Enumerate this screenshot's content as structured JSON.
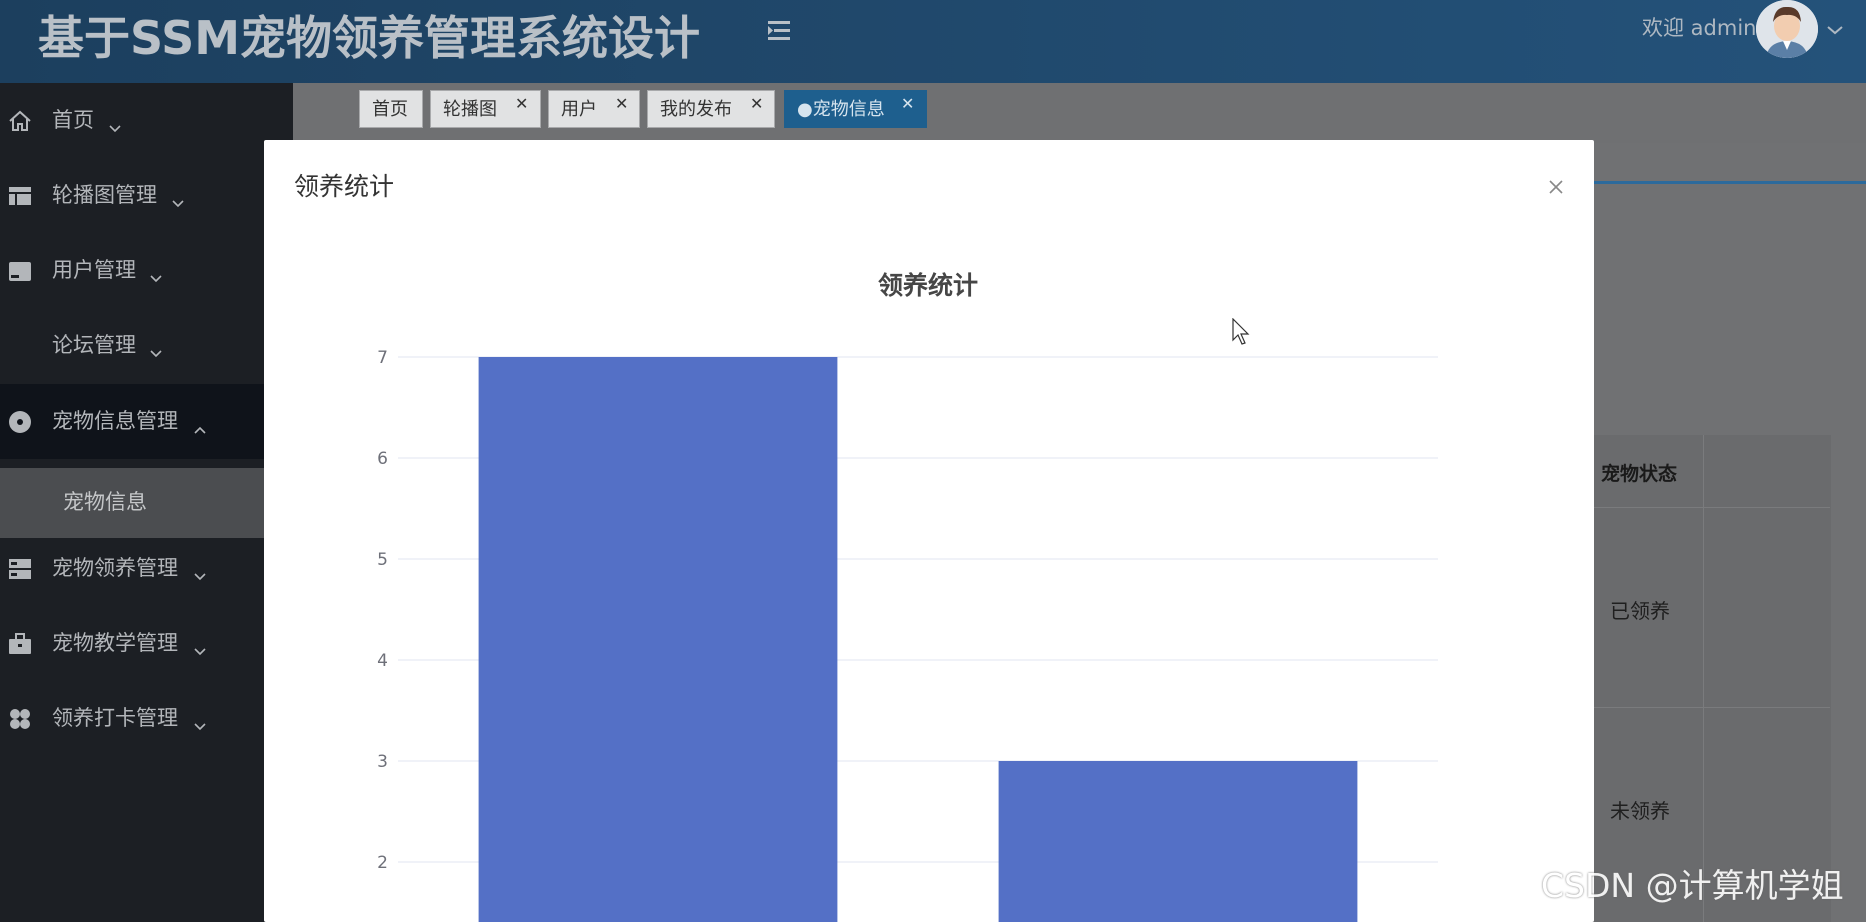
{
  "header": {
    "app_title": "基于SSM宠物领养管理系统设计",
    "welcome": "欢迎 admin"
  },
  "sidebar": {
    "items": [
      {
        "label": "首页",
        "icon": "home-icon"
      },
      {
        "label": "轮播图管理",
        "icon": "layout-icon"
      },
      {
        "label": "用户管理",
        "icon": "drive-icon"
      },
      {
        "label": "论坛管理",
        "icon": ""
      },
      {
        "label": "宠物信息管理",
        "icon": "disc-icon"
      },
      {
        "label": "宠物领养管理",
        "icon": "server-icon"
      },
      {
        "label": "宠物教学管理",
        "icon": "briefcase-icon"
      },
      {
        "label": "领养打卡管理",
        "icon": "clover-icon"
      }
    ],
    "sub_item": "宠物信息"
  },
  "tabs": [
    {
      "label": "首页"
    },
    {
      "label": "轮播图"
    },
    {
      "label": "用户"
    },
    {
      "label": "我的发布"
    },
    {
      "label": "●宠物信息"
    }
  ],
  "background_table": {
    "header": "宠物状态",
    "rows": [
      "已领养",
      "未领养"
    ]
  },
  "modal": {
    "title": "领养统计"
  },
  "chart_data": {
    "type": "bar",
    "title": "领养统计",
    "categories": [
      "",
      ""
    ],
    "values": [
      7,
      3
    ],
    "ylim": [
      2,
      7
    ],
    "yticks": [
      2,
      3,
      4,
      5,
      6,
      7
    ],
    "grid": true,
    "bar_color": "#5470c6"
  },
  "watermark": "CSDN @计算机学姐",
  "colors": {
    "header_bg": "#1f4667",
    "sidebar_bg": "#1c1f24",
    "active_tab": "#1e5f8e",
    "bar": "#5470c6"
  }
}
